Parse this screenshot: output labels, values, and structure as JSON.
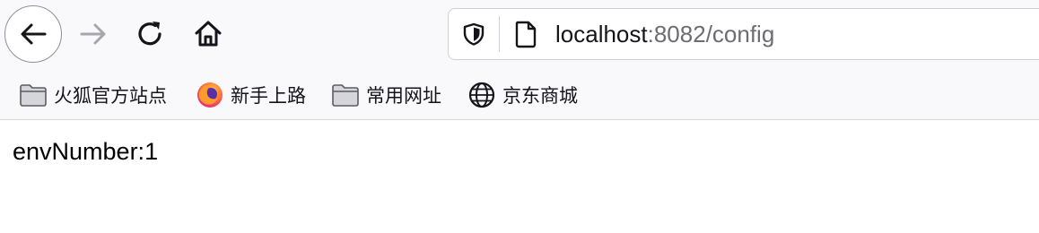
{
  "toolbar": {
    "back_icon": "arrow-left-icon",
    "forward_icon": "arrow-right-icon",
    "reload_icon": "reload-icon",
    "home_icon": "home-icon"
  },
  "urlbar": {
    "shield_icon": "shield-icon",
    "page_icon": "page-icon",
    "host": "localhost",
    "rest": ":8082/config"
  },
  "bookmarks": [
    {
      "label": "火狐官方站点",
      "icon": "folder-icon"
    },
    {
      "label": "新手上路",
      "icon": "firefox-icon"
    },
    {
      "label": "常用网址",
      "icon": "folder-icon"
    },
    {
      "label": "京东商城",
      "icon": "globe-icon"
    }
  ],
  "page": {
    "text": "envNumber:1"
  },
  "colors": {
    "toolbar_bg": "#f9f9fb",
    "icon": "#15141a",
    "icon_disabled": "#a6a6ac",
    "url_dim": "#6c6c72"
  }
}
